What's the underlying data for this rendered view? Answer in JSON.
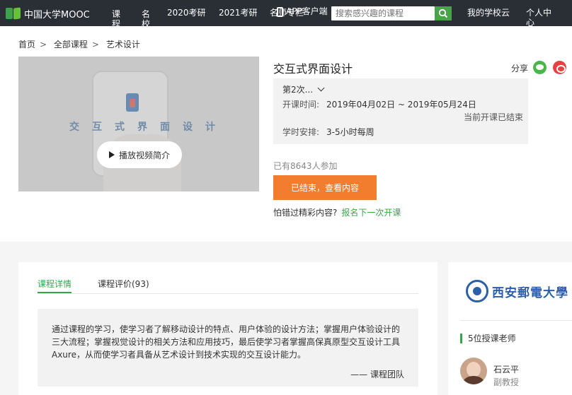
{
  "header": {
    "logo_text": "中国大学MOOC",
    "nav": {
      "course": "课程",
      "famous": "名校",
      "kaoyan2020": "2020考研",
      "kaoyan2021": "2021考研",
      "teacher": "名师专栏",
      "app": "APP客户端"
    },
    "search_placeholder": "搜索感兴趣的课程",
    "my_school": "我的学校云",
    "personal_center": "个人中心"
  },
  "breadcrumb": [
    "首页",
    "全部课程",
    "艺术设计"
  ],
  "video": {
    "overlay_text": "交互式界面设计",
    "play_label": "播放视频简介"
  },
  "course": {
    "title": "交互式界面设计",
    "share_label": "分享",
    "term": "第2次...",
    "time_label": "开课时间:",
    "time_value": "2019年04月02日 ~ 2019年05月24日",
    "status": "当前开课已结束",
    "hours_label": "学时安排:",
    "hours_value": "3-5小时每周",
    "enrolled": "已有8643人参加",
    "enter_button": "已结束，查看内容",
    "missed_text": "怕错过精彩内容?",
    "missed_link": "报名下一次开课"
  },
  "tabs": {
    "details": "课程详情",
    "reviews": "课程评价(93)"
  },
  "intro": {
    "text": "通过课程的学习，使学习者了解移动设计的特点、用户体验的设计方法；掌握用户体验设计的三大流程；掌握视觉设计的相关方法和应用技巧，最后使学习者掌握高保真原型交互设计工具Axure，从而使学习者具备从艺术设计到技术实现的交互设计能力。",
    "sign": "—— 课程团队"
  },
  "sidebar": {
    "school_name": "西安郵電大學",
    "teachers_heading": "5位授课老师",
    "teacher_name": "石云平",
    "teacher_title": "副教授"
  },
  "colors": {
    "topbar": "#2a2f36",
    "accent_green": "#3aa350",
    "orange": "#f27d2f",
    "school_blue": "#2c5fa8"
  }
}
